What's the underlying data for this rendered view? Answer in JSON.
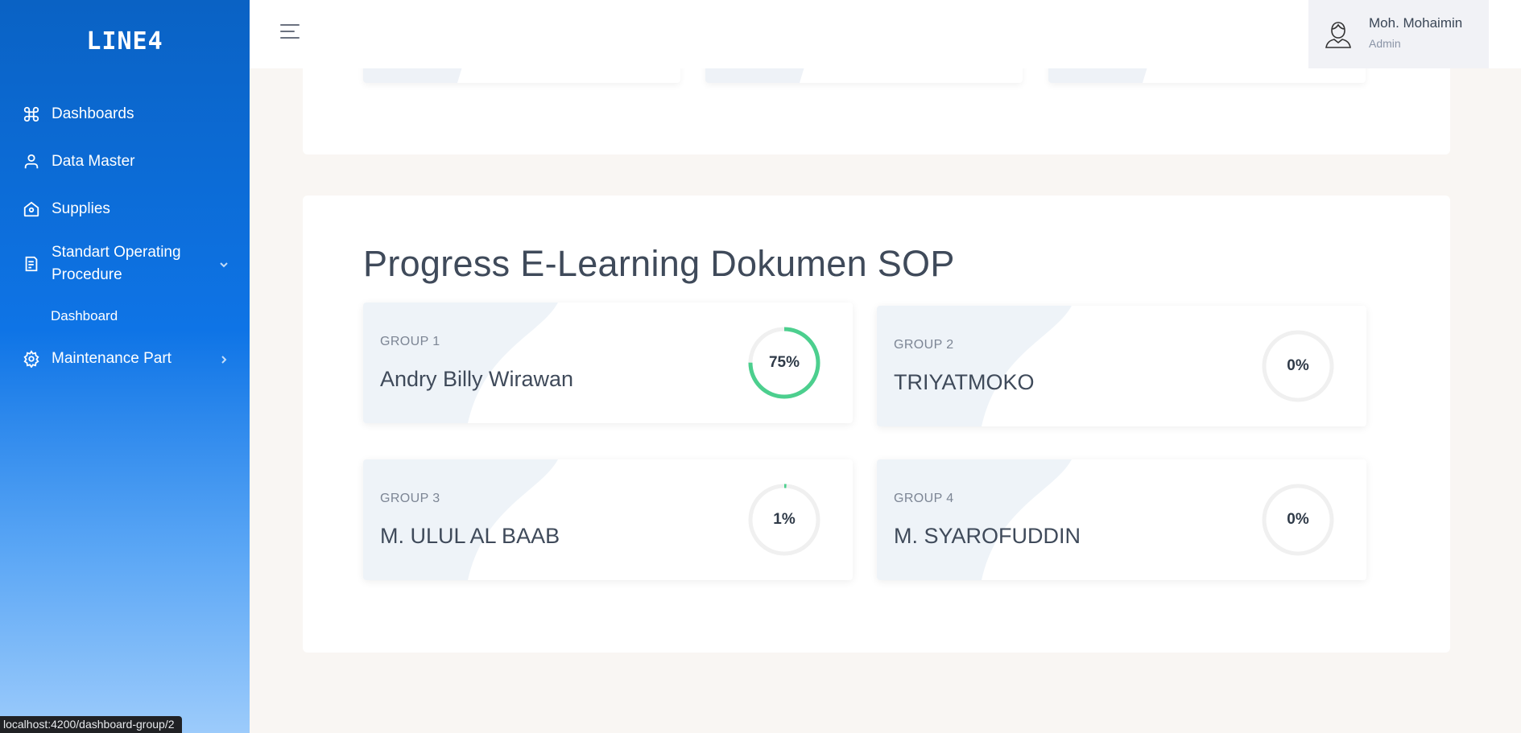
{
  "sidebar": {
    "logo": "LINE4",
    "items": [
      {
        "label": "Dashboards",
        "icon": "command-icon"
      },
      {
        "label": "Data Master",
        "icon": "user-icon"
      },
      {
        "label": "Supplies",
        "icon": "home-icon"
      },
      {
        "label": "Standart Operating Procedure",
        "icon": "document-icon",
        "line1": "Standart Operating",
        "line2": "Procedure"
      },
      {
        "label": "Maintenance Part",
        "icon": "gear-icon"
      }
    ],
    "sub_items": [
      {
        "label": "Dashboard"
      }
    ]
  },
  "header": {
    "user": {
      "name": "Moh. Mohaimin",
      "role": "Admin"
    }
  },
  "main": {
    "section_title": "Progress E-Learning Dokumen SOP",
    "groups": [
      {
        "group": "GROUP 1",
        "name": "Andry Billy Wirawan",
        "percent_label": "75%",
        "progress": 0.75
      },
      {
        "group": "GROUP 2",
        "name": "TRIYATMOKO",
        "percent_label": "0%",
        "progress": 0
      },
      {
        "group": "GROUP 3",
        "name": "M. ULUL AL BAAB",
        "percent_label": "1%",
        "progress": 0.01
      },
      {
        "group": "GROUP 4",
        "name": "M. SYAROFUDDIN",
        "percent_label": "0%",
        "progress": 0
      }
    ]
  },
  "colors": {
    "sidebar_top": "#0a62c4",
    "sidebar_bottom": "#9ccbfb",
    "progress_ring": "#4ccf8e",
    "ring_track": "#f0f0f0"
  },
  "statusbar": {
    "url": "localhost:4200/dashboard-group/2"
  }
}
